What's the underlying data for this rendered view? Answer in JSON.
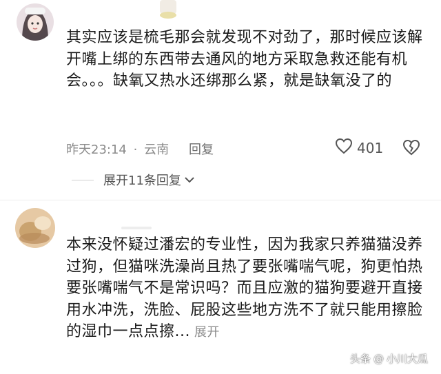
{
  "comments": [
    {
      "text": "其实应该是梳毛那会就发现不对劲了，那时候应该解开嘴上绑的东西带去通风的地方采取急救还能有机会。。。缺氧又热水还绑那么紧，就是缺氧没了的",
      "time": "昨天23:14",
      "separator": "·",
      "location": "云南",
      "reply_label": "回复",
      "like_count": "401",
      "expand_replies_label": "展开11条回复"
    },
    {
      "text": "本来没怀疑过潘宏的专业性，因为我家只养猫猫没养过狗，但猫咪洗澡尚且热了要张嘴喘气呢，狗更怕热要张嘴喘气不是常识吗？而且应激的猫狗要避开直接用水冲洗，洗脸、屁股这些地方洗不了就只能用擦脸的湿巾一点点擦...",
      "expand_label": "展开"
    }
  ],
  "watermark": {
    "source": "头条",
    "at": "@",
    "author": "小川大瓜"
  },
  "icons": {
    "like": "heart-outline-icon",
    "dislike": "broken-heart-icon",
    "expand": "chevron-down-icon"
  },
  "colors": {
    "text": "#1a1a1a",
    "meta": "#8a8a8a"
  }
}
